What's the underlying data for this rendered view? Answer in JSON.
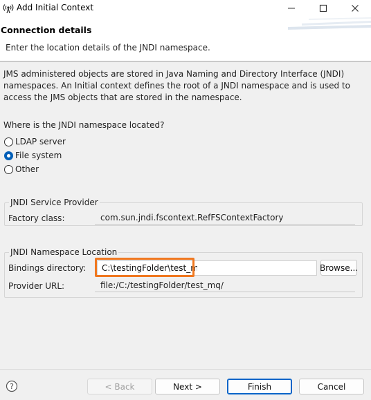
{
  "window": {
    "title": "Add Initial Context",
    "app_icon": "radio-signal-icon",
    "controls": [
      "minimize-icon",
      "maximize-icon",
      "close-icon"
    ]
  },
  "banner": {
    "title": "Connection details",
    "description": "Enter the location details of the JNDI namespace."
  },
  "intro": "JMS administered objects are stored in Java Naming and Directory Interface (JNDI) namespaces. An Initial context defines the root of a JNDI namespace and is used to access the JMS objects that are stored in the namespace.",
  "location": {
    "question": "Where is the JNDI namespace located?",
    "options": [
      {
        "label": "LDAP server",
        "checked": false
      },
      {
        "label": "File system",
        "checked": true
      },
      {
        "label": "Other",
        "checked": false
      }
    ]
  },
  "service_provider": {
    "group_label": "JNDI Service Provider",
    "factory_label": "Factory class:",
    "factory_value": "com.sun.jndi.fscontext.RefFSContextFactory"
  },
  "namespace_location": {
    "group_label": "JNDI Namespace Location",
    "bindings_label": "Bindings directory:",
    "bindings_value": "C:\\testingFolder\\test_mq",
    "browse_label": "Browse...",
    "provider_label": "Provider URL:",
    "provider_value": "file:/C:/testingFolder/test_mq/"
  },
  "footer": {
    "help_icon": "help-icon",
    "back_label": "< Back",
    "next_label": "Next >",
    "finish_label": "Finish",
    "cancel_label": "Cancel"
  },
  "colors": {
    "highlight": "#f07820",
    "accent": "#005fb8"
  }
}
